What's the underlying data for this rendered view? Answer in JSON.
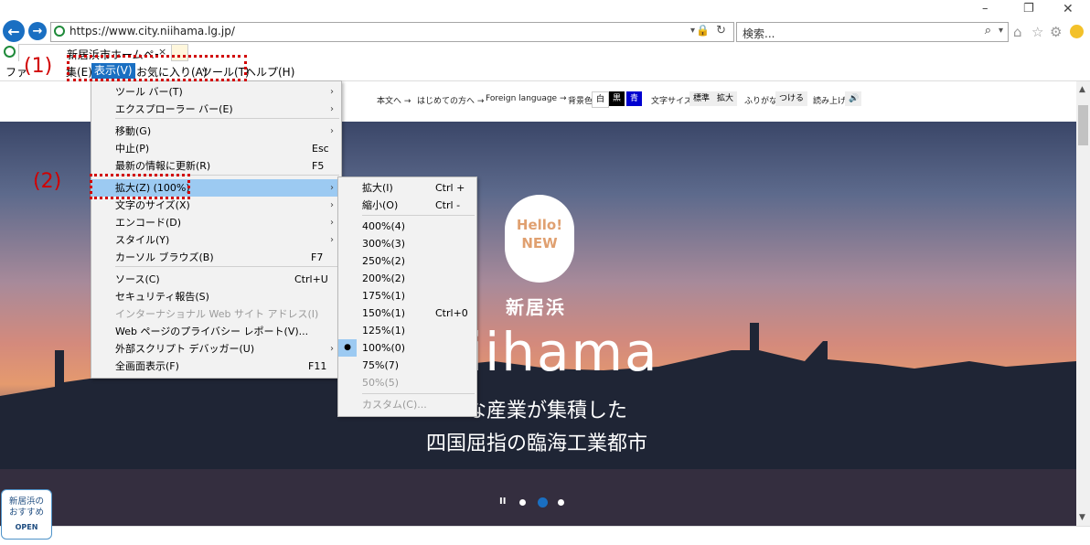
{
  "browser": {
    "url": "https://www.city.niihama.lg.jp/",
    "search_placeholder": "検索...",
    "tab_title": "新居浜市ホームページ",
    "window_minimize": "–",
    "window_restore": "❐",
    "window_close": "✕"
  },
  "menubar": [
    "ファイル(F)",
    "編集(E)",
    "表示(V)",
    "お気に入り(A)",
    "ツール(T)",
    "ヘルプ(H)"
  ],
  "menubar_visible": [
    "ファ",
    "集(E)",
    "表示(V)",
    "お気に入り(A)",
    "ツール(T)",
    "ヘルプ(H)"
  ],
  "view_menu": [
    {
      "label": "ツール バー(T)",
      "shortcut": "",
      "submenu": true
    },
    {
      "label": "エクスプローラー バー(E)",
      "shortcut": "",
      "submenu": true
    },
    {
      "label": "移動(G)",
      "shortcut": "",
      "submenu": true
    },
    {
      "label": "中止(P)",
      "shortcut": "Esc"
    },
    {
      "label": "最新の情報に更新(R)",
      "shortcut": "F5"
    },
    {
      "label": "拡大(Z) (100%)",
      "shortcut": "",
      "submenu": true,
      "highlighted": true
    },
    {
      "label": "文字のサイズ(X)",
      "shortcut": "",
      "submenu": true
    },
    {
      "label": "エンコード(D)",
      "shortcut": "",
      "submenu": true
    },
    {
      "label": "スタイル(Y)",
      "shortcut": "",
      "submenu": true
    },
    {
      "label": "カーソル ブラウズ(B)",
      "shortcut": "F7"
    },
    {
      "label": "ソース(C)",
      "shortcut": "Ctrl+U"
    },
    {
      "label": "セキュリティ報告(S)",
      "shortcut": ""
    },
    {
      "label": "インターナショナル Web サイト アドレス(I)",
      "shortcut": "",
      "disabled": true
    },
    {
      "label": "Web ページのプライバシー レポート(V)...",
      "shortcut": ""
    },
    {
      "label": "外部スクリプト デバッガー(U)",
      "shortcut": "",
      "submenu": true
    },
    {
      "label": "全画面表示(F)",
      "shortcut": "F11"
    }
  ],
  "zoom_menu": [
    {
      "label": "拡大(I)",
      "shortcut": "Ctrl +"
    },
    {
      "label": "縮小(O)",
      "shortcut": "Ctrl -"
    },
    {
      "label": "400%(4)",
      "shortcut": ""
    },
    {
      "label": "300%(3)",
      "shortcut": ""
    },
    {
      "label": "250%(2)",
      "shortcut": ""
    },
    {
      "label": "200%(2)",
      "shortcut": ""
    },
    {
      "label": "175%(1)",
      "shortcut": ""
    },
    {
      "label": "150%(1)",
      "shortcut": "Ctrl+0"
    },
    {
      "label": "125%(1)",
      "shortcut": ""
    },
    {
      "label": "100%(0)",
      "shortcut": "",
      "checked": true
    },
    {
      "label": "75%(7)",
      "shortcut": ""
    },
    {
      "label": "50%(5)",
      "shortcut": "",
      "disabled": true
    },
    {
      "label": "カスタム(C)...",
      "shortcut": "",
      "disabled": true
    }
  ],
  "callouts": {
    "one": "(1)",
    "two": "(2)"
  },
  "site": {
    "nav_links": [
      "本文へ →",
      "はじめての方へ →",
      "Foreign language →"
    ],
    "bg_label": "背景色",
    "bg_white": "白",
    "bg_black": "黒",
    "bg_blue": "青",
    "text_size_label": "文字サイズ",
    "text_standard": "標準",
    "text_large": "拡大",
    "furigana_label": "ふりがな",
    "furigana_button": "つける",
    "read_aloud": "読み上げ",
    "bubble_line1": "Hello!",
    "bubble_line2": "NEW",
    "city_kanji": "新居浜",
    "city_roman": "iihama",
    "tagline1": "な産業が集積した",
    "tagline2": "四国屈指の臨海工業都市",
    "pause": "II",
    "badge_line1": "新居浜の",
    "badge_line2": "おすすめ",
    "badge_open": "OPEN"
  },
  "colors": {
    "highlight": "#9ccaf2",
    "callout": "#d10000",
    "ie_blue": "#1a6fc2"
  }
}
